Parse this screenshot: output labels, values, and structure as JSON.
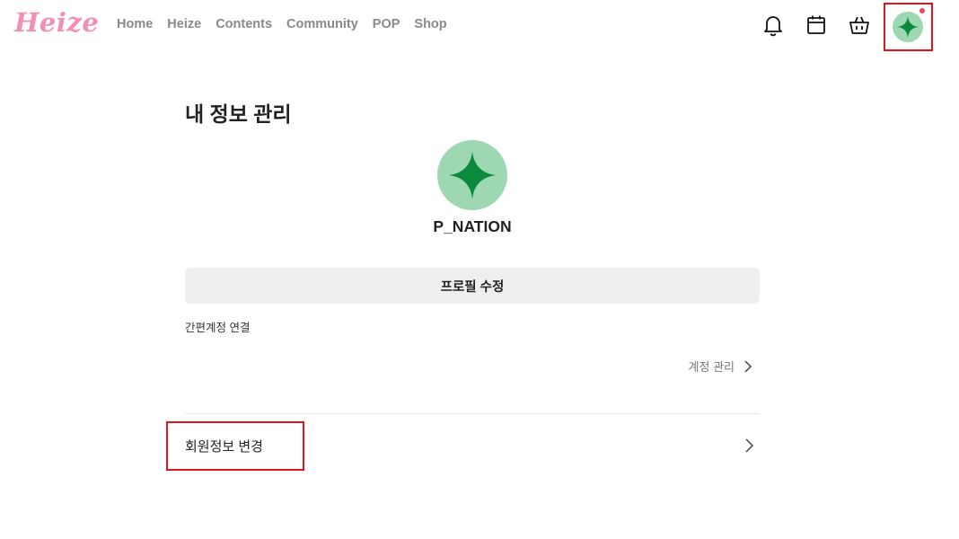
{
  "header": {
    "logo": "Heize",
    "nav": [
      "Home",
      "Heize",
      "Contents",
      "Community",
      "POP",
      "Shop"
    ],
    "icons": [
      "bell-icon",
      "calendar-icon",
      "shopping-bag-icon"
    ],
    "avatar_color": "#9ed8b2",
    "avatar_star_color": "#0b8a3d",
    "notification_dot_color": "#f0475a"
  },
  "main": {
    "title": "내 정보 관리",
    "profile": {
      "name": "P_NATION"
    },
    "edit_profile_button": "프로필 수정",
    "sns_section_label": "간편계정 연결",
    "account_manage_link": "계정 관리",
    "member_info_change": "회원정보 변경"
  },
  "colors": {
    "logo": "#f28fb4",
    "nav_text": "#8a8a8a",
    "highlight_box": "#e0141e",
    "button_bg": "#efefef"
  }
}
